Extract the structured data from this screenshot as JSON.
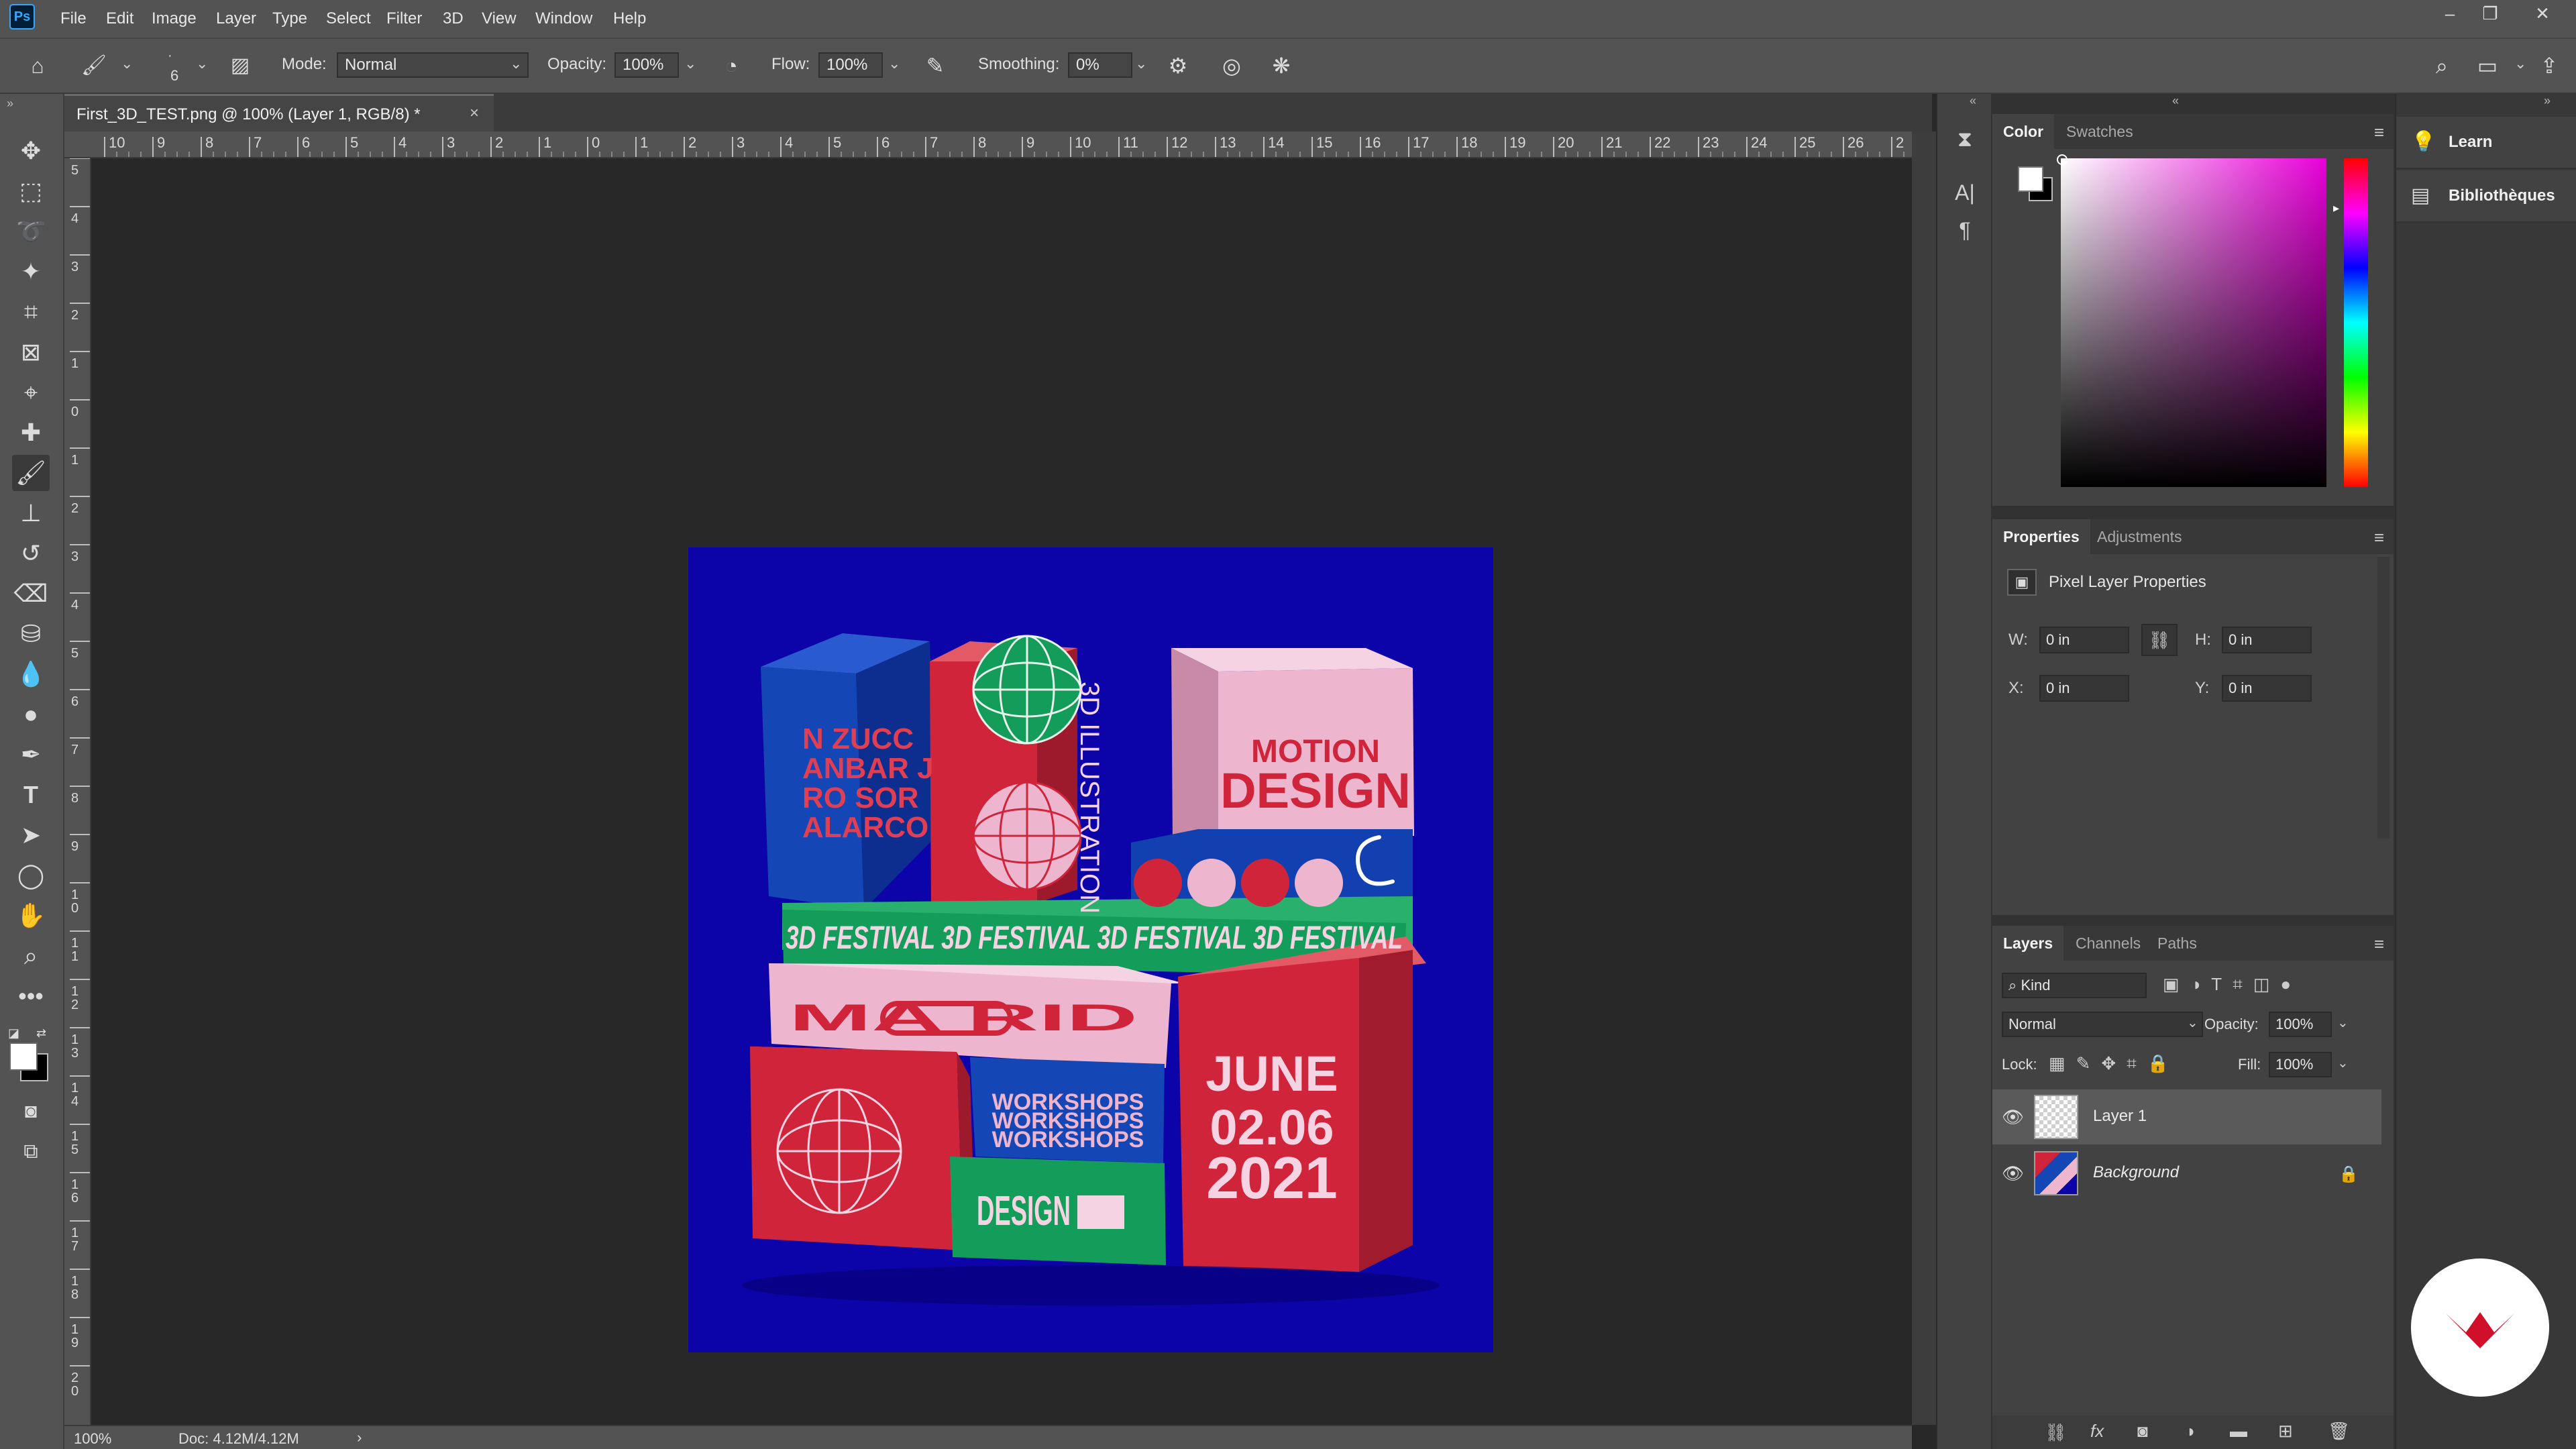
{
  "app": {
    "logo": "Ps",
    "menu": [
      "File",
      "Edit",
      "Image",
      "Layer",
      "Type",
      "Select",
      "Filter",
      "3D",
      "View",
      "Window",
      "Help"
    ],
    "window_controls": [
      "minimize-icon",
      "restore-icon",
      "close-icon"
    ]
  },
  "options": {
    "brush_size": "6",
    "mode_label": "Mode:",
    "mode_value": "Normal",
    "opacity_label": "Opacity:",
    "opacity_value": "100%",
    "flow_label": "Flow:",
    "flow_value": "100%",
    "smoothing_label": "Smoothing:",
    "smoothing_value": "0%"
  },
  "document": {
    "tab_title": "First_3D_TEST.png @ 100% (Layer 1, RGB/8) *",
    "zoom": "100%",
    "doc_info": "Doc: 4.12M/4.12M"
  },
  "ruler": {
    "top_ticks": [
      "10",
      "9",
      "8",
      "7",
      "6",
      "5",
      "4",
      "3",
      "2",
      "1",
      "0",
      "1",
      "2",
      "3",
      "4",
      "5",
      "6",
      "7",
      "8",
      "9",
      "10",
      "11",
      "12",
      "13",
      "14",
      "15",
      "16",
      "17",
      "18",
      "19",
      "20",
      "21",
      "22",
      "23",
      "24",
      "25",
      "26",
      "2"
    ],
    "left_ticks": [
      "5",
      "4",
      "3",
      "2",
      "1",
      "0",
      "1",
      "2",
      "3",
      "4",
      "5",
      "6",
      "7",
      "8",
      "9",
      "1 0",
      "1 1",
      "1 2",
      "1 3",
      "1 4",
      "1 5",
      "1 6",
      "1 7",
      "1 8",
      "1 9",
      "2 0"
    ]
  },
  "artwork": {
    "left_box_text": [
      "N ZUCC",
      "ANBAR J",
      "RO SOR",
      "ALARCO"
    ],
    "vertical_text": "3D ILLUSTRATION",
    "motion_design": [
      "MOTION",
      "DESIGN"
    ],
    "festival_band": "3D FESTIVAL 3D FESTIVAL 3D FESTIVAL 3D FESTIVAL",
    "madrid": "MA    RID",
    "workshops": [
      "WORKSHOPS",
      "WORKSHOPS",
      "WORKSHOPS"
    ],
    "design": "DESIGN",
    "date": [
      "JUNE",
      "02.06",
      "2021"
    ],
    "colors": {
      "background": "#0c03a8",
      "red": "#d0243a",
      "pink": "#eeb5cf",
      "green": "#149c5a",
      "blue": "#1340b0"
    }
  },
  "panels": {
    "color": {
      "tabs": [
        "Color",
        "Swatches"
      ],
      "hue": "#e800d8"
    },
    "properties": {
      "tabs": [
        "Properties",
        "Adjustments"
      ],
      "header": "Pixel Layer Properties",
      "w_label": "W:",
      "w_value": "0 in",
      "h_label": "H:",
      "h_value": "0 in",
      "x_label": "X:",
      "x_value": "0 in",
      "y_label": "Y:",
      "y_value": "0 in"
    },
    "layers": {
      "tabs": [
        "Layers",
        "Channels",
        "Paths"
      ],
      "filter_value": "Kind",
      "blend_mode": "Normal",
      "opacity_label": "Opacity:",
      "opacity_value": "100%",
      "lock_label": "Lock:",
      "fill_label": "Fill:",
      "fill_value": "100%",
      "items": [
        {
          "name": "Layer 1",
          "selected": true
        },
        {
          "name": "Background",
          "locked": true
        }
      ]
    }
  },
  "right_column": {
    "items": [
      {
        "label": "Learn",
        "icon": "lightbulb-icon"
      },
      {
        "label": "Bibliothèques",
        "icon": "libraries-icon"
      }
    ]
  }
}
